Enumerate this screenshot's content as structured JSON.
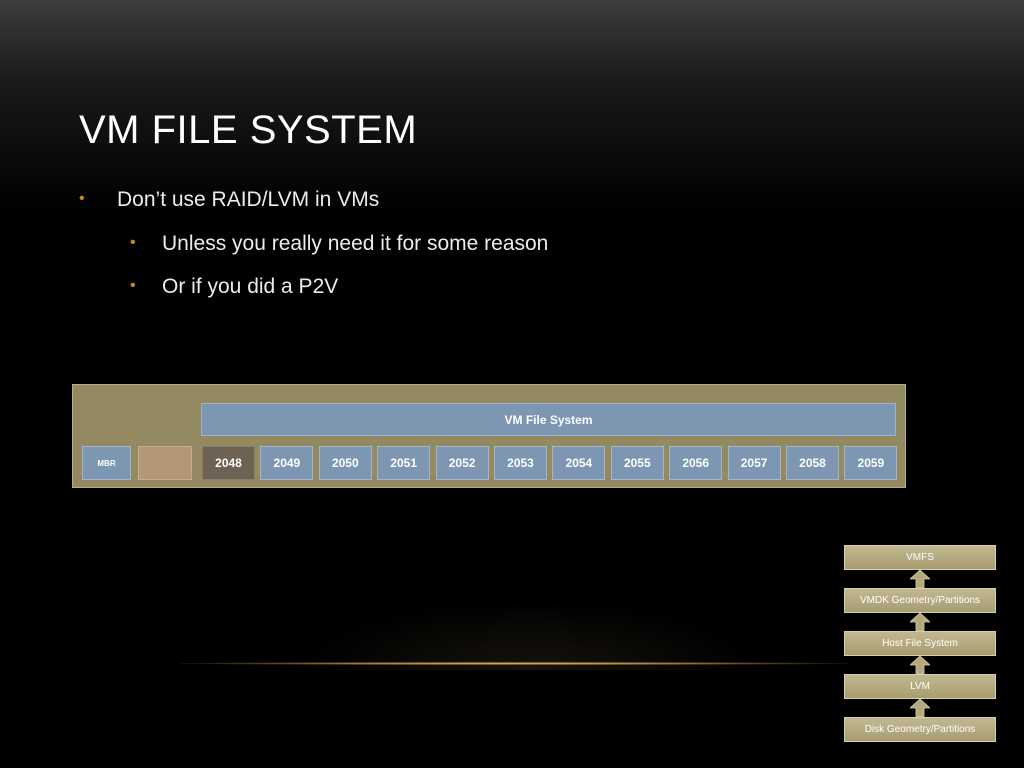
{
  "slide": {
    "title": "VM FILE SYSTEM"
  },
  "bullets": [
    {
      "level": 1,
      "text": "Don’t use RAID/LVM in VMs"
    },
    {
      "level": 2,
      "text": "Unless you really need it for some reason"
    },
    {
      "level": 2,
      "text": "Or if you did a P2V"
    }
  ],
  "disk_diagram": {
    "file_system_label": "VM File System",
    "mbr_label": "MBR",
    "blocks": [
      "2048",
      "2049",
      "2050",
      "2051",
      "2052",
      "2053",
      "2054",
      "2055",
      "2056",
      "2057",
      "2058",
      "2059"
    ],
    "highlighted_block": "2048"
  },
  "layer_stack": {
    "layers": [
      "VMFS",
      "VMDK Geometry/Partitions",
      "Host File System",
      "LVM",
      "Disk Geometry/Partitions"
    ]
  },
  "colors": {
    "accent": "#c98a2e",
    "panel": "#938a62",
    "block": "#7d97b2",
    "block_highlight": "#6e6253",
    "block_gap": "#b39776",
    "layer": "#b3a97c"
  }
}
